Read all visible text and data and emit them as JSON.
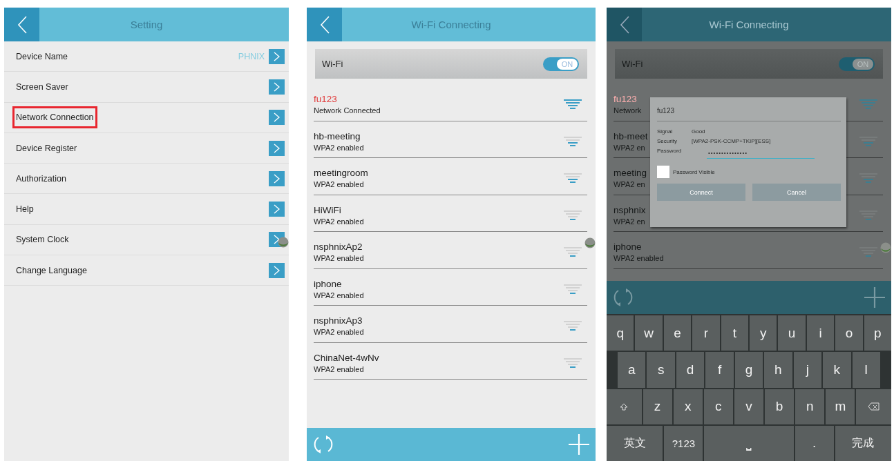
{
  "screens": [
    {
      "kind": "settings",
      "title": "Setting",
      "dimmed": false,
      "items": [
        {
          "label": "Device Name",
          "value": "PHNIX",
          "highlighted": false
        },
        {
          "label": "Screen Saver",
          "highlighted": false
        },
        {
          "label": "Network Connection",
          "highlighted": true
        },
        {
          "label": "Device Register",
          "highlighted": false
        },
        {
          "label": "Authorization",
          "highlighted": false
        },
        {
          "label": "Help",
          "highlighted": false
        },
        {
          "label": "System Clock",
          "highlighted": false
        },
        {
          "label": "Change Language",
          "highlighted": false
        }
      ]
    },
    {
      "kind": "wifi",
      "title": "Wi-Fi Connecting",
      "dimmed": false,
      "wifi": {
        "label": "Wi-Fi",
        "on": true,
        "switch_text": "ON"
      },
      "networks": [
        {
          "name": "fu123",
          "status": "Network Connected",
          "connected": true,
          "kind": "strong"
        },
        {
          "name": "hb-meeting",
          "status": "WPA2 enabled",
          "connected": false,
          "kind": "good"
        },
        {
          "name": "meetingroom",
          "status": "WPA2 enabled",
          "connected": false,
          "kind": "good"
        },
        {
          "name": "HiWiFi",
          "status": "WPA2 enabled",
          "connected": false,
          "kind": "weak"
        },
        {
          "name": "nsphnixAp2",
          "status": "WPA2 enabled",
          "connected": false,
          "kind": "weak"
        },
        {
          "name": "iphone",
          "status": "WPA2 enabled",
          "connected": false,
          "kind": "weak"
        },
        {
          "name": "nsphnixAp3",
          "status": "WPA2 enabled",
          "connected": false,
          "kind": "weak"
        },
        {
          "name": "ChinaNet-4wNv",
          "status": "WPA2 enabled",
          "connected": false,
          "kind": "weak"
        }
      ]
    },
    {
      "kind": "wifi",
      "title": "Wi-Fi Connecting",
      "dimmed": true,
      "wifi": {
        "label": "Wi-Fi",
        "on": true,
        "switch_text": "ON"
      },
      "networks": [
        {
          "name": "fu123",
          "status": "Network",
          "connected": true,
          "kind": "strong"
        },
        {
          "name": "hb-meet",
          "status": "WPA2 en",
          "connected": false,
          "kind": "good"
        },
        {
          "name": "meeting",
          "status": "WPA2 en",
          "connected": false,
          "kind": "good"
        },
        {
          "name": "nsphnix",
          "status": "WPA2 en",
          "connected": false,
          "kind": "weak"
        },
        {
          "name": "iphone",
          "status": "WPA2 enabled",
          "connected": false,
          "kind": "weak"
        }
      ],
      "dialog": {
        "title": "fu123",
        "fields": [
          {
            "label": "Signal",
            "value": "Good"
          },
          {
            "label": "Security",
            "value": "[WPA2-PSK-CCMP+TKIP][ESS]"
          }
        ],
        "password_label": "Password",
        "password": "•••••••••••••••",
        "show_password": {
          "label": "Password Visible",
          "checked": false
        },
        "buttons": [
          "Connect",
          "Cancel"
        ]
      },
      "keyboard": [
        [
          {
            "kind": "char",
            "label": "q"
          },
          {
            "kind": "char",
            "label": "w"
          },
          {
            "kind": "char",
            "label": "e"
          },
          {
            "kind": "char",
            "label": "r"
          },
          {
            "kind": "char",
            "label": "t"
          },
          {
            "kind": "char",
            "label": "y"
          },
          {
            "kind": "char",
            "label": "u"
          },
          {
            "kind": "char",
            "label": "i"
          },
          {
            "kind": "char",
            "label": "o"
          },
          {
            "kind": "char",
            "label": "p"
          }
        ],
        [
          {
            "kind": "char",
            "label": "a"
          },
          {
            "kind": "char",
            "label": "s"
          },
          {
            "kind": "char",
            "label": "d"
          },
          {
            "kind": "char",
            "label": "f"
          },
          {
            "kind": "char",
            "label": "g"
          },
          {
            "kind": "char",
            "label": "h"
          },
          {
            "kind": "char",
            "label": "j"
          },
          {
            "kind": "char",
            "label": "k"
          },
          {
            "kind": "char",
            "label": "l"
          }
        ],
        [
          {
            "kind": "shift"
          },
          {
            "kind": "char",
            "label": "z"
          },
          {
            "kind": "char",
            "label": "x"
          },
          {
            "kind": "char",
            "label": "c"
          },
          {
            "kind": "char",
            "label": "v"
          },
          {
            "kind": "char",
            "label": "b"
          },
          {
            "kind": "char",
            "label": "n"
          },
          {
            "kind": "char",
            "label": "m"
          },
          {
            "kind": "backspace"
          }
        ],
        [
          {
            "kind": "wide",
            "label": "英文"
          },
          {
            "kind": "char",
            "label": "?123"
          },
          {
            "kind": "space",
            "label": "⎵"
          },
          {
            "kind": "char",
            "label": "."
          },
          {
            "kind": "wide",
            "label": "完成"
          }
        ]
      ]
    }
  ]
}
